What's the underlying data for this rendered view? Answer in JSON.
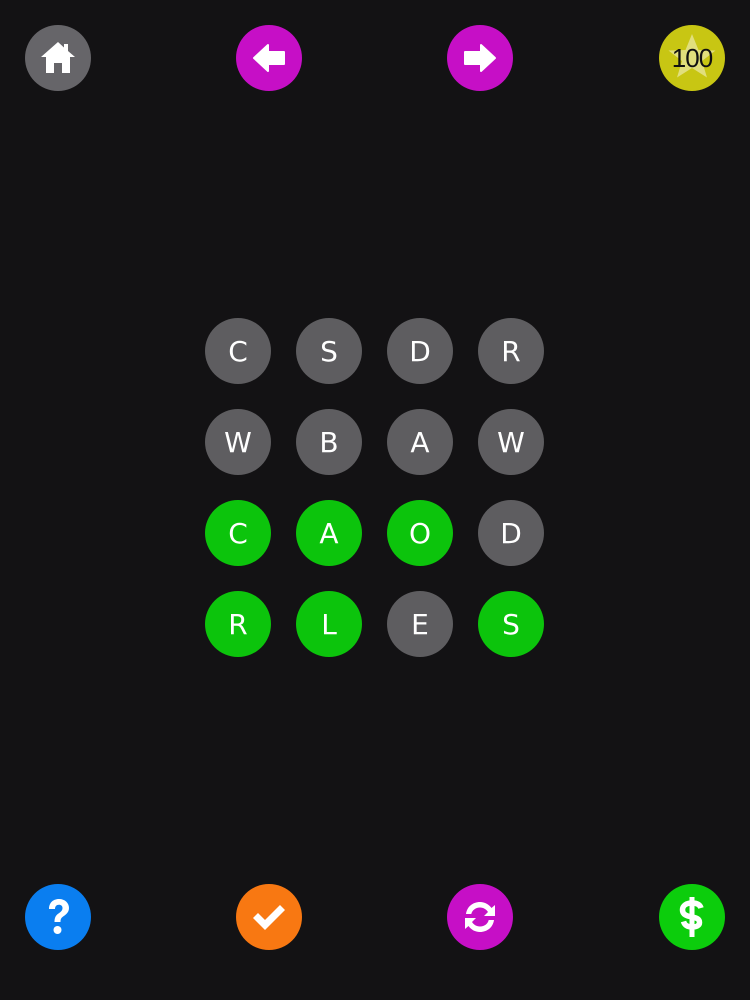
{
  "header": {
    "home_icon": "home-icon",
    "prev_icon": "arrow-left-icon",
    "next_icon": "arrow-right-icon",
    "coins_icon": "star-icon",
    "coins": "100"
  },
  "colors": {
    "background": "#131214",
    "tile_idle": "#5e5d60",
    "tile_selected": "#0cc40c",
    "home": "#666569",
    "nav": "#c60fc6",
    "coins": "#c8c613",
    "help": "#0a7ef0",
    "check": "#f87812",
    "shop": "#0ccd0c"
  },
  "board": {
    "rows": [
      [
        {
          "letter": "C",
          "state": "idle"
        },
        {
          "letter": "S",
          "state": "idle"
        },
        {
          "letter": "D",
          "state": "idle"
        },
        {
          "letter": "R",
          "state": "idle"
        }
      ],
      [
        {
          "letter": "W",
          "state": "idle"
        },
        {
          "letter": "B",
          "state": "idle"
        },
        {
          "letter": "A",
          "state": "idle"
        },
        {
          "letter": "W",
          "state": "idle"
        }
      ],
      [
        {
          "letter": "C",
          "state": "selected"
        },
        {
          "letter": "A",
          "state": "selected"
        },
        {
          "letter": "O",
          "state": "selected"
        },
        {
          "letter": "D",
          "state": "idle"
        }
      ],
      [
        {
          "letter": "R",
          "state": "selected"
        },
        {
          "letter": "L",
          "state": "selected"
        },
        {
          "letter": "E",
          "state": "idle"
        },
        {
          "letter": "S",
          "state": "selected"
        }
      ]
    ]
  },
  "footer": {
    "help_icon": "question-mark-icon",
    "check_icon": "checkmark-icon",
    "reset_icon": "refresh-icon",
    "shop_icon": "dollar-icon"
  }
}
